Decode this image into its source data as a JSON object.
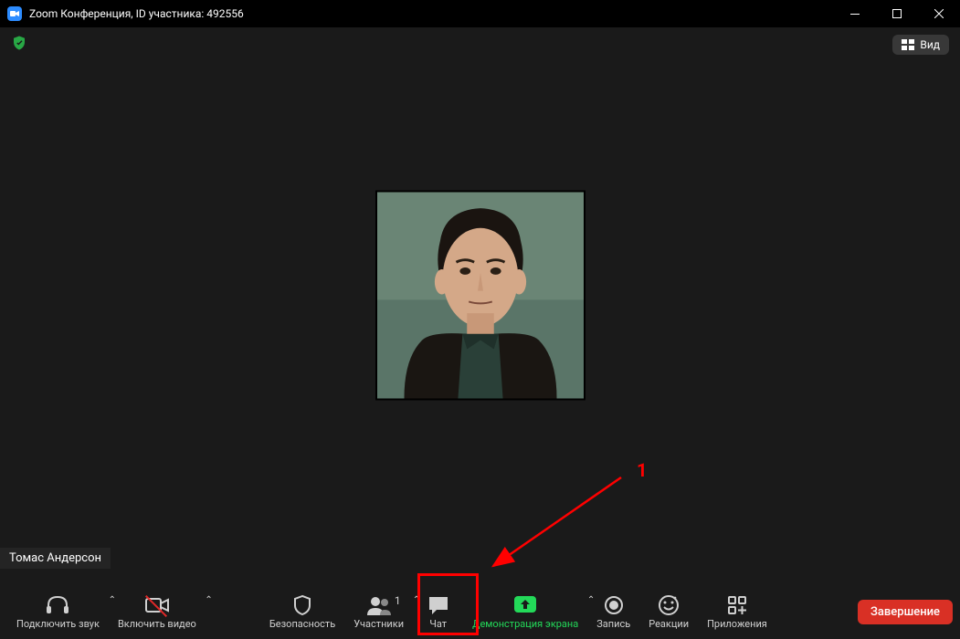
{
  "window": {
    "title": "Zoom Конференция, ID участника: 492556"
  },
  "topbar": {
    "view_label": "Вид"
  },
  "participant": {
    "name": "Томас Андерсон"
  },
  "toolbar": {
    "audio_label": "Подключить звук",
    "video_label": "Включить видео",
    "security_label": "Безопасность",
    "participants_label": "Участники",
    "participants_count": "1",
    "chat_label": "Чат",
    "share_label": "Демонстрация экрана",
    "record_label": "Запись",
    "reactions_label": "Реакции",
    "apps_label": "Приложения",
    "end_label": "Завершение"
  },
  "annotation": {
    "number": "1"
  }
}
